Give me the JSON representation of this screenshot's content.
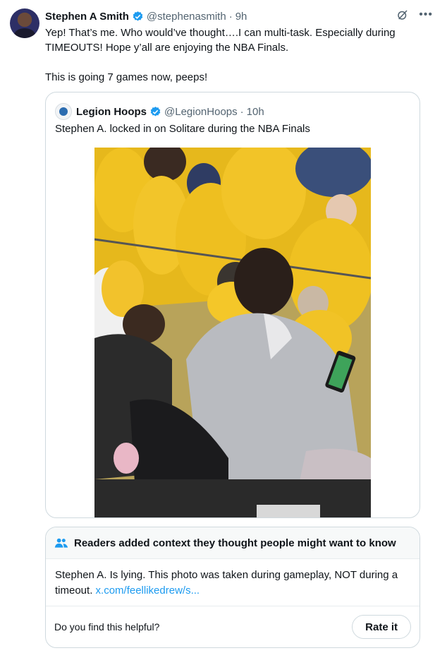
{
  "tweet": {
    "author_name": "Stephen A Smith",
    "author_handle": "@stephenasmith",
    "separator": "·",
    "time": "9h",
    "text": "Yep! That’s me. Who would’ve thought….I can multi-task. Especially during TIMEOUTS! Hope y’all are enjoying the NBA Finals.\n\nThis is going 7 games now, peeps!",
    "more_icon": "more-horizontal-icon",
    "grok_icon": "grok-icon",
    "verified_color": "#1d9bf0"
  },
  "quote": {
    "author_name": "Legion Hoops",
    "author_handle": "@LegionHoops",
    "separator": "·",
    "time": "10h",
    "text": "Stephen A. locked in on Solitare during the NBA Finals"
  },
  "community_note": {
    "title": "Readers added context they thought people might want to know",
    "body": "Stephen A. Is lying. This photo was taken during gameplay, NOT during a timeout. ",
    "link_text": "x.com/feellikedrew/s...",
    "helpful_prompt": "Do you find this helpful?",
    "rate_button": "Rate it",
    "link_color": "#1d9bf0"
  }
}
